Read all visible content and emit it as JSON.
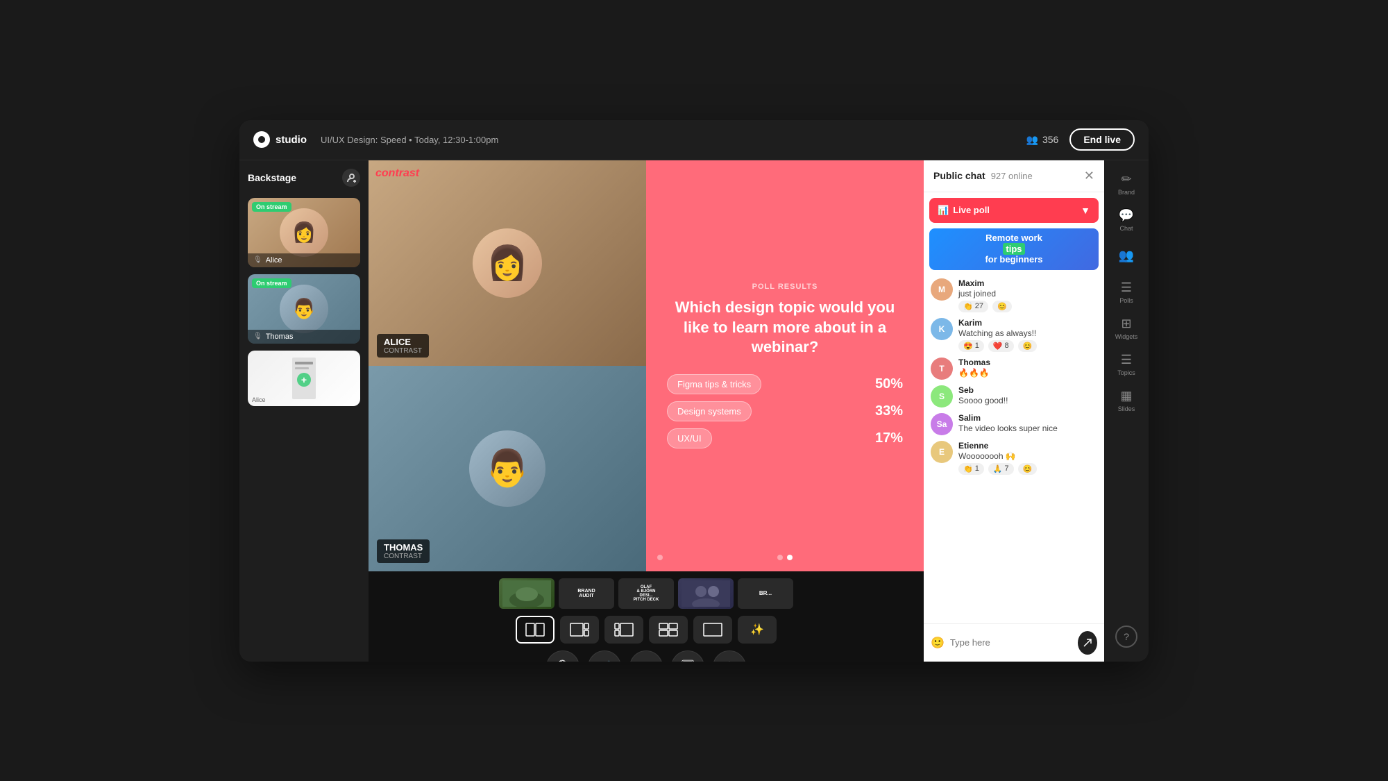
{
  "app": {
    "logo_label": "studio",
    "session_info": "UI/UX Design: Speed • Today, 12:30-1:00pm",
    "viewers_count": "356",
    "end_live_label": "End live"
  },
  "sidebar": {
    "title": "Backstage",
    "add_btn_label": "+",
    "participants": [
      {
        "id": "alice",
        "name": "Alice",
        "on_stream": true,
        "badge": "On stream"
      },
      {
        "id": "thomas",
        "name": "Thomas",
        "on_stream": true,
        "badge": "On stream"
      },
      {
        "id": "slide",
        "name": "Alice",
        "on_stream": false
      }
    ]
  },
  "main_video": {
    "top_person": {
      "name": "ALICE",
      "brand": "CONTRAST"
    },
    "bottom_person": {
      "name": "THOMAS",
      "brand": "CONTRAST"
    },
    "brand_label": "contrast"
  },
  "poll": {
    "results_label": "POLL RESULTS",
    "question": "Which design topic would you like to learn more about in a webinar?",
    "options": [
      {
        "label": "Figma tips & tricks",
        "percent": "50%"
      },
      {
        "label": "Design systems",
        "percent": "33%"
      },
      {
        "label": "UX/UI",
        "percent": "17%"
      }
    ]
  },
  "thumbnails": [
    {
      "id": "nature",
      "label": ""
    },
    {
      "id": "brand-audit",
      "label": "BRAND AUDIT"
    },
    {
      "id": "pitch",
      "label": "OLAF & BJÖRN DESI..."
    },
    {
      "id": "people",
      "label": ""
    },
    {
      "id": "partial",
      "label": "BR..."
    }
  ],
  "layout_buttons": [
    {
      "id": "split",
      "active": true
    },
    {
      "id": "left-main",
      "active": false
    },
    {
      "id": "right-main",
      "active": false
    },
    {
      "id": "grid",
      "active": false
    },
    {
      "id": "single",
      "active": false
    },
    {
      "id": "magic",
      "active": false
    }
  ],
  "controls": [
    {
      "id": "mic",
      "icon": "🎙"
    },
    {
      "id": "camera",
      "icon": "📹"
    },
    {
      "id": "persons",
      "icon": "👥"
    },
    {
      "id": "screen",
      "icon": "🖥"
    },
    {
      "id": "settings",
      "icon": "⚙"
    }
  ],
  "chat": {
    "title": "Public chat",
    "online_count": "927 online",
    "live_poll_label": "Live poll",
    "promo_line1": "Remote work",
    "promo_highlight": "tips",
    "promo_line2": "for beginners",
    "messages": [
      {
        "user": "Maxim",
        "avatar_color": "#e8a87c",
        "initials": "M",
        "text": "just joined",
        "reactions": [
          {
            "emoji": "👏",
            "count": "27"
          },
          {
            "emoji": "😊",
            "count": ""
          }
        ]
      },
      {
        "user": "Karim",
        "avatar_color": "#7cb8e8",
        "initials": "K",
        "text": "Watching as always!!",
        "reactions": [
          {
            "emoji": "😍",
            "count": "1"
          },
          {
            "emoji": "❤️",
            "count": "8"
          },
          {
            "emoji": "😊",
            "count": ""
          }
        ]
      },
      {
        "user": "Thomas",
        "avatar_color": "#e87c7c",
        "initials": "T",
        "text": "🔥🔥🔥",
        "reactions": []
      },
      {
        "user": "Seb",
        "avatar_color": "#8ce87c",
        "initials": "S",
        "text": "Soooo good!!",
        "reactions": []
      },
      {
        "user": "Salim",
        "avatar_color": "#c87ce8",
        "initials": "Sa",
        "text": "The video looks super nice",
        "reactions": []
      },
      {
        "user": "Etienne",
        "avatar_color": "#e8c87c",
        "initials": "E",
        "text": "Woooooooh 🙌",
        "reactions": [
          {
            "emoji": "👏",
            "count": "1"
          },
          {
            "emoji": "🙏",
            "count": "7"
          },
          {
            "emoji": "😊",
            "count": ""
          }
        ]
      }
    ],
    "input_placeholder": "Type here"
  },
  "right_sidebar": [
    {
      "id": "brand",
      "icon": "✏",
      "label": "Brand"
    },
    {
      "id": "chat-icon",
      "icon": "💬",
      "label": "Chat"
    },
    {
      "id": "people-icon",
      "icon": "👥",
      "label": ""
    },
    {
      "id": "chat2",
      "icon": "💬",
      "label": "Chat"
    },
    {
      "id": "polls",
      "icon": "☰",
      "label": "Polls"
    },
    {
      "id": "widgets",
      "icon": "⊞",
      "label": "Widgets"
    },
    {
      "id": "topics",
      "icon": "☰",
      "label": "Topics"
    },
    {
      "id": "slides",
      "icon": "▦",
      "label": "Slides"
    }
  ]
}
